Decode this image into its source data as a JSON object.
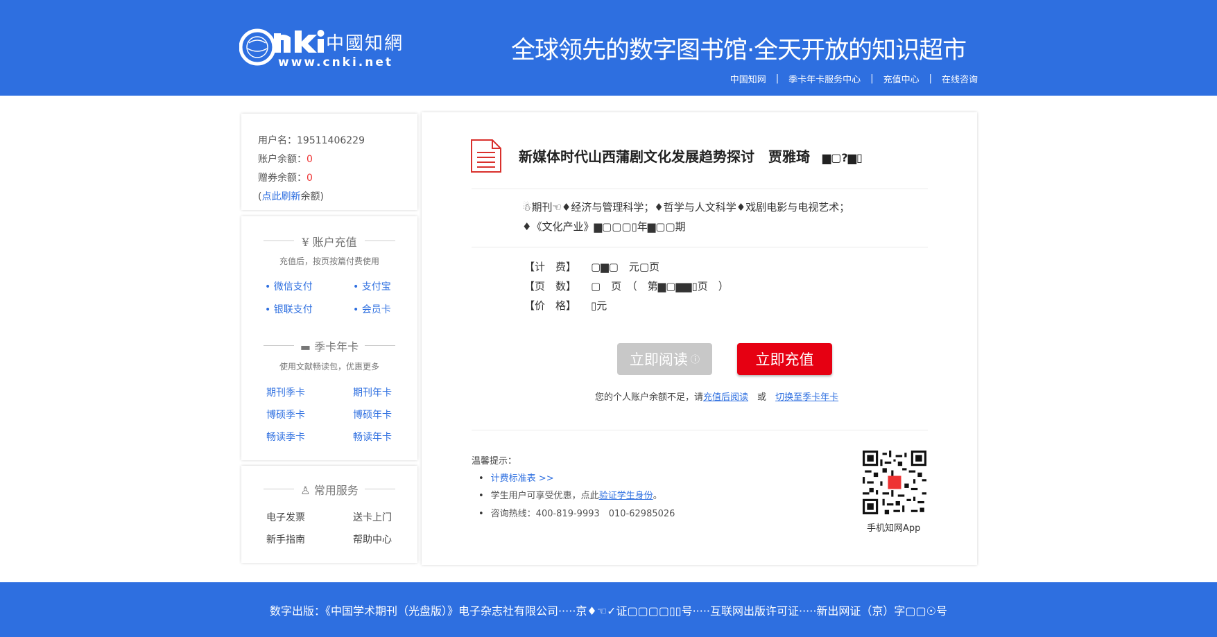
{
  "brand": {
    "logo_text": "cnki",
    "logo_cn": "中國知網",
    "url": "www.cnki.net",
    "slogan": "全球领先的数字图书馆·全天开放的知识超市",
    "color": "#2e6fe0"
  },
  "topnav": [
    "中国知网",
    "季卡年卡服务中心",
    "充值中心",
    "在线咨询"
  ],
  "user": {
    "username": "用户名：19511406229",
    "balance_label": "账户余额：",
    "balance": "0",
    "coupon_label": "赠券余额：",
    "coupon": "0",
    "refresh_open": "(",
    "refresh_link": "点此刷新",
    "refresh_tail": "余额)"
  },
  "recharge": {
    "title": "账户充值",
    "sub": "充值后，按页按篇付费使用",
    "links": [
      "微信支付",
      "支付宝",
      "银联支付",
      "会员卡"
    ]
  },
  "cards": {
    "title": "季卡年卡",
    "sub": "使用文献畅读包，优惠更多",
    "links": [
      "期刊季卡",
      "期刊年卡",
      "博硕季卡",
      "博硕年卡",
      "畅读季卡",
      "畅读年卡"
    ]
  },
  "services": {
    "title": "常用服务",
    "items": [
      "电子发票",
      "送卡上门",
      "新手指南",
      "帮助中心"
    ]
  },
  "doc": {
    "title": "新媒体时代山西蒲剧文化发展趋势探讨",
    "author": "贾雅琦",
    "extra": "▆▢?▆▯",
    "meta1": "☃期刊☜♦经济与管理科学；♦哲学与人文科学♦戏剧电影与电视艺术；",
    "meta2": "♦《文化产业》▆▢▢▢▯年▆▢▢期",
    "fee_k": "【计　费】",
    "fee_v": "▢▆▢　元▢页",
    "pages_k": "【页　数】",
    "pages_v": "▢　页　（　第▆▢▆▆▯页　）",
    "price_k": "【价　格】",
    "price_v": "▯元"
  },
  "buttons": {
    "read": "立即阅读",
    "charge": "立即充值"
  },
  "notice": {
    "text": "您的个人账户余额不足，请",
    "link1": "充值后阅读",
    "or": "或",
    "link2": "切换至季卡年卡"
  },
  "tips": {
    "title": "温馨提示：",
    "tip1": "计费标准表 >>",
    "tip2_pre": "学生用户可享受优惠，点此",
    "tip2_link": "验证学生身份",
    "tip2_post": "。",
    "tip3": "咨询热线：400-819-9993　010-62985026"
  },
  "qr_label": "手机知网App",
  "footer": "数字出版：《中国学术期刊（光盘版）》电子杂志社有限公司·····京♦☜✓证▢▢▢▢▯▯号·····互联网出版许可证·····新出网证（京）字▢▢☉号"
}
